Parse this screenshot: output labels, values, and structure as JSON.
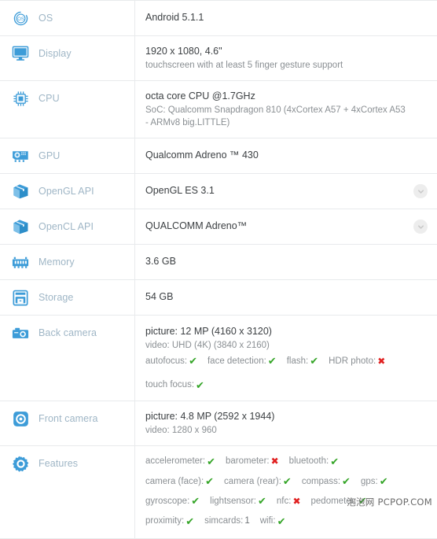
{
  "sheet": {
    "accent_icon_color": "#3d9cd8",
    "label_color": "#9fb6c6",
    "yes_color": "#35a528",
    "no_color": "#e02020",
    "rows": [
      {
        "icon": "os-icon",
        "label": "OS",
        "main": "Android 5.1.1",
        "sub": ""
      },
      {
        "icon": "display-monitor-icon",
        "label": "Display",
        "main": "1920 x 1080, 4.6\"",
        "sub": "touchscreen with at least 5 finger gesture support"
      },
      {
        "icon": "cpu-chip-icon",
        "label": "CPU",
        "main": "octa core CPU @1.7GHz",
        "sub": "SoC: Qualcomm Snapdragon 810 (4xCortex A57 + 4xCortex A53 - ARMv8 big.LITTLE)"
      },
      {
        "icon": "gpu-card-icon",
        "label": "GPU",
        "main": "Qualcomm Adreno ™ 430",
        "sub": ""
      },
      {
        "icon": "api-box-icon",
        "label": "OpenGL API",
        "main": "OpenGL ES 3.1",
        "sub": "",
        "chevron": "chevron-down-icon"
      },
      {
        "icon": "api-box-icon",
        "label": "OpenCL API",
        "main": "QUALCOMM Adreno™",
        "sub": "",
        "chevron": "chevron-down-icon"
      },
      {
        "icon": "memory-ram-icon",
        "label": "Memory",
        "main": "3.6 GB",
        "sub": ""
      },
      {
        "icon": "storage-icon",
        "label": "Storage",
        "main": "54 GB",
        "sub": ""
      },
      {
        "icon": "back-camera-icon",
        "label": "Back camera",
        "main": "picture: 12 MP (4160 x 3120)",
        "sub": "video: UHD (4K) (3840 x 2160)"
      },
      {
        "icon": "front-camera-icon",
        "label": "Front camera",
        "main": "picture: 4.8 MP (2592 x 1944)",
        "sub": "video: 1280 x 960"
      },
      {
        "icon": "features-gear-icon",
        "label": "Features",
        "main": "",
        "sub": ""
      }
    ]
  },
  "back_camera_flags_line1": [
    {
      "name": "autofocus",
      "sep": ":",
      "value": "✔",
      "state": "yes"
    },
    {
      "name": "face detection",
      "sep": ":",
      "value": "✔",
      "state": "yes"
    },
    {
      "name": "flash",
      "sep": ":",
      "value": "✔",
      "state": "yes"
    },
    {
      "name": "HDR photo",
      "sep": ":",
      "value": "✖",
      "state": "no"
    }
  ],
  "back_camera_flags_line2": [
    {
      "name": "touch focus",
      "sep": ":",
      "value": "✔",
      "state": "yes"
    }
  ],
  "features_lines": [
    [
      {
        "name": "accelerometer",
        "sep": ":",
        "value": "✔",
        "state": "yes"
      },
      {
        "name": "barometer",
        "sep": ":",
        "value": "✖",
        "state": "no"
      },
      {
        "name": "bluetooth",
        "sep": ":",
        "value": "✔",
        "state": "yes"
      }
    ],
    [
      {
        "name": "camera (face)",
        "sep": ":",
        "value": "✔",
        "state": "yes"
      },
      {
        "name": "camera (rear)",
        "sep": ":",
        "value": "✔",
        "state": "yes"
      },
      {
        "name": "compass",
        "sep": ":",
        "value": "✔",
        "state": "yes"
      },
      {
        "name": "gps",
        "sep": ":",
        "value": "✔",
        "state": "yes"
      }
    ],
    [
      {
        "name": "gyroscope",
        "sep": ":",
        "value": "✔",
        "state": "yes"
      },
      {
        "name": "lightsensor",
        "sep": ":",
        "value": "✔",
        "state": "yes"
      },
      {
        "name": "nfc",
        "sep": ":",
        "value": "✖",
        "state": "no"
      },
      {
        "name": "pedometer",
        "sep": ":",
        "value": "✔",
        "state": "yes"
      }
    ],
    [
      {
        "name": "proximity",
        "sep": ":",
        "value": "✔",
        "state": "yes"
      },
      {
        "name": "simcards",
        "sep": ":",
        "value": "1",
        "state": "num"
      },
      {
        "name": "wifi",
        "sep": ":",
        "value": "✔",
        "state": "yes"
      }
    ]
  ],
  "watermark": "泡泡网  PCPOP.COM"
}
